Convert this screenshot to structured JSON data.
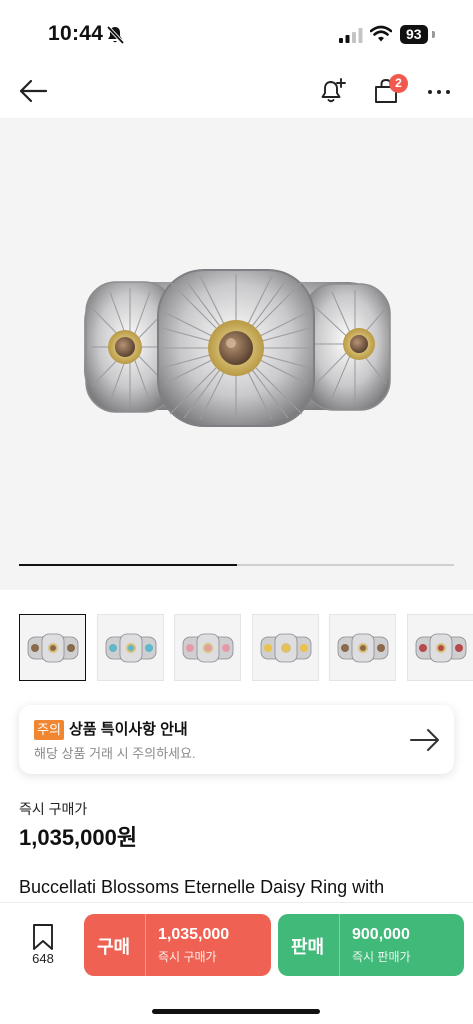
{
  "status_bar": {
    "time": "10:44",
    "battery": "93"
  },
  "nav": {
    "cart_count": "2"
  },
  "hero": {
    "carousel_progress": 0.5
  },
  "thumbnails": [
    {
      "gem": "#8a6a4a",
      "selected": true
    },
    {
      "gem": "#5fb7c8",
      "selected": false
    },
    {
      "gem": "#e59aa8",
      "selected": false
    },
    {
      "gem": "#e9c24a",
      "selected": false
    },
    {
      "gem": "#8a6a4a",
      "selected": false
    },
    {
      "gem": "#b64a4a",
      "selected": false
    }
  ],
  "notice": {
    "badge": "주의",
    "title": "상품 특이사항 안내",
    "subtitle": "해당 상품 거래 시 주의하세요."
  },
  "price": {
    "label": "즉시 구매가",
    "value": "1,035,000원"
  },
  "product": {
    "name": "Buccellati Blossoms Eternelle Daisy Ring with"
  },
  "bottom_bar": {
    "wish_count": "648",
    "buy": {
      "label": "구매",
      "price": "1,035,000",
      "sub": "즉시 구매가"
    },
    "sell": {
      "label": "판매",
      "price": "900,000",
      "sub": "즉시 판매가"
    }
  },
  "colors": {
    "buy": "#ef6253",
    "sell": "#41b979",
    "badge": "#f1594e",
    "notice_badge": "#f08632"
  }
}
